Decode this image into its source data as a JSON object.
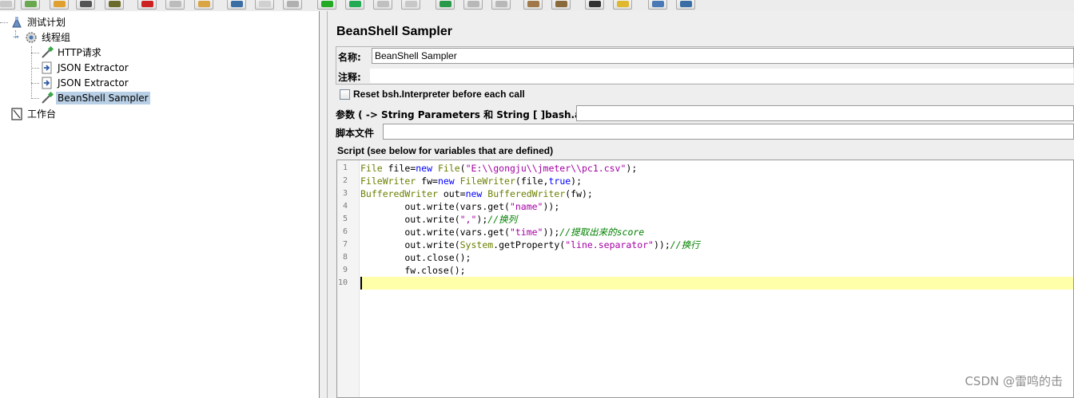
{
  "toolbar": {
    "buttons": [
      {
        "icon": "new-icon",
        "color": "#c8c8c8"
      },
      {
        "icon": "templates-icon",
        "color": "#6aa84f"
      },
      {
        "icon": "open-icon",
        "color": "#e0a030"
      },
      {
        "icon": "save-icon",
        "color": "#555555"
      },
      {
        "icon": "save-as-icon",
        "color": "#6b6b2b"
      },
      {
        "icon": "cut-icon",
        "color": "#cc2222"
      },
      {
        "icon": "copy-icon",
        "color": "#bcbcbc"
      },
      {
        "icon": "paste-icon",
        "color": "#d9a441"
      },
      {
        "icon": "expand-icon",
        "color": "#3a6ea5"
      },
      {
        "icon": "collapse-icon",
        "color": "#d0d0d0"
      },
      {
        "icon": "toggle-icon",
        "color": "#b0b0b0"
      },
      {
        "icon": "start-icon",
        "color": "#22aa22"
      },
      {
        "icon": "start-no-pauses-icon",
        "color": "#22aa55"
      },
      {
        "icon": "stop-icon",
        "color": "#c0c0c0"
      },
      {
        "icon": "shutdown-icon",
        "color": "#c8c8c8"
      },
      {
        "icon": "remote-start-icon",
        "color": "#2a9a4a"
      },
      {
        "icon": "remote-stop-icon",
        "color": "#b8b8b8"
      },
      {
        "icon": "remote-shutdown-icon",
        "color": "#b8b8b8"
      },
      {
        "icon": "clear-icon",
        "color": "#a0784a"
      },
      {
        "icon": "clear-all-icon",
        "color": "#8a6a3a"
      },
      {
        "icon": "search-icon",
        "color": "#333333"
      },
      {
        "icon": "reset-search-icon",
        "color": "#e0b830"
      },
      {
        "icon": "function-helper-icon",
        "color": "#4a7ab5"
      },
      {
        "icon": "help-icon",
        "color": "#3a6ea5"
      }
    ]
  },
  "tree": {
    "test_plan": "测试计划",
    "thread_group": "线程组",
    "children": [
      "HTTP请求",
      "JSON Extractor",
      "JSON Extractor",
      "BeanShell Sampler"
    ],
    "workbench": "工作台"
  },
  "panel": {
    "title": "BeanShell Sampler",
    "name_label": "名称:",
    "name_value": "BeanShell Sampler",
    "comment_label": "注释:",
    "comment_value": "",
    "reset_label": "Reset bsh.Interpreter before each call",
    "reset_checked": false,
    "params_label": "参数 ( -> String Parameters 和 String [ ]bash.args)",
    "params_value": "",
    "file_label": "脚本文件",
    "file_value": "",
    "script_label": "Script (see below for variables that are defined)"
  },
  "script": {
    "lines": [
      {
        "n": "1",
        "text": "File file=new File(\"E:\\\\gongju\\\\jmeter\\\\pc1.csv\");"
      },
      {
        "n": "2",
        "text": "FileWriter fw=new FileWriter(file,true);"
      },
      {
        "n": "3",
        "text": "BufferedWriter out=new BufferedWriter(fw);"
      },
      {
        "n": "4",
        "text": "        out.write(vars.get(\"name\"));"
      },
      {
        "n": "5",
        "text": "        out.write(\",\");//换列"
      },
      {
        "n": "6",
        "text": "        out.write(vars.get(\"time\"));//提取出来的score"
      },
      {
        "n": "7",
        "text": "        out.write(System.getProperty(\"line.separator\"));//换行"
      },
      {
        "n": "8",
        "text": "        out.close();"
      },
      {
        "n": "9",
        "text": "        fw.close();"
      },
      {
        "n": "10",
        "text": ""
      }
    ],
    "current_line": "10"
  },
  "watermark": "CSDN @雷鸣的击"
}
